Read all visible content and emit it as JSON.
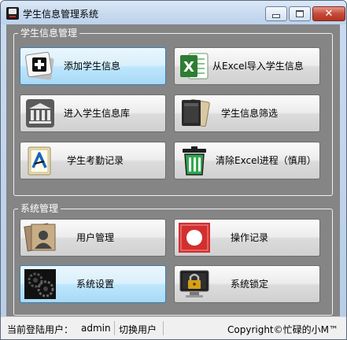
{
  "window": {
    "title": "学生信息管理系统",
    "controls": {
      "minimize": "minimize",
      "maximize": "maximize",
      "close": "✕"
    }
  },
  "groups": {
    "student": {
      "title": "学生信息管理",
      "tiles": [
        {
          "label": "添加学生信息",
          "icon": "add-icon"
        },
        {
          "label": "从Excel导入学生信息",
          "icon": "excel-icon"
        },
        {
          "label": "进入学生信息库",
          "icon": "library-icon"
        },
        {
          "label": "学生信息筛选",
          "icon": "filter-icon"
        },
        {
          "label": "学生考勤记录",
          "icon": "attendance-icon"
        },
        {
          "label": "清除Excel进程（慎用）",
          "icon": "trash-icon"
        }
      ]
    },
    "system": {
      "title": "系统管理",
      "tiles": [
        {
          "label": "用户管理",
          "icon": "user-icon"
        },
        {
          "label": "操作记录",
          "icon": "record-icon"
        },
        {
          "label": "系统设置",
          "icon": "settings-icon"
        },
        {
          "label": "系统锁定",
          "icon": "lock-icon"
        }
      ]
    }
  },
  "status": {
    "current_user_label": "当前登陆用户：",
    "current_user": "admin",
    "switch_user": "切换用户",
    "copyright": "Copyright©忙碌的小M™"
  },
  "colors": {
    "panel_bg": "#858585",
    "active_tile": "#bee6fd",
    "excel_green": "#2e7d32",
    "trash_green": "#2fa84f",
    "record_red": "#d32f2f"
  }
}
